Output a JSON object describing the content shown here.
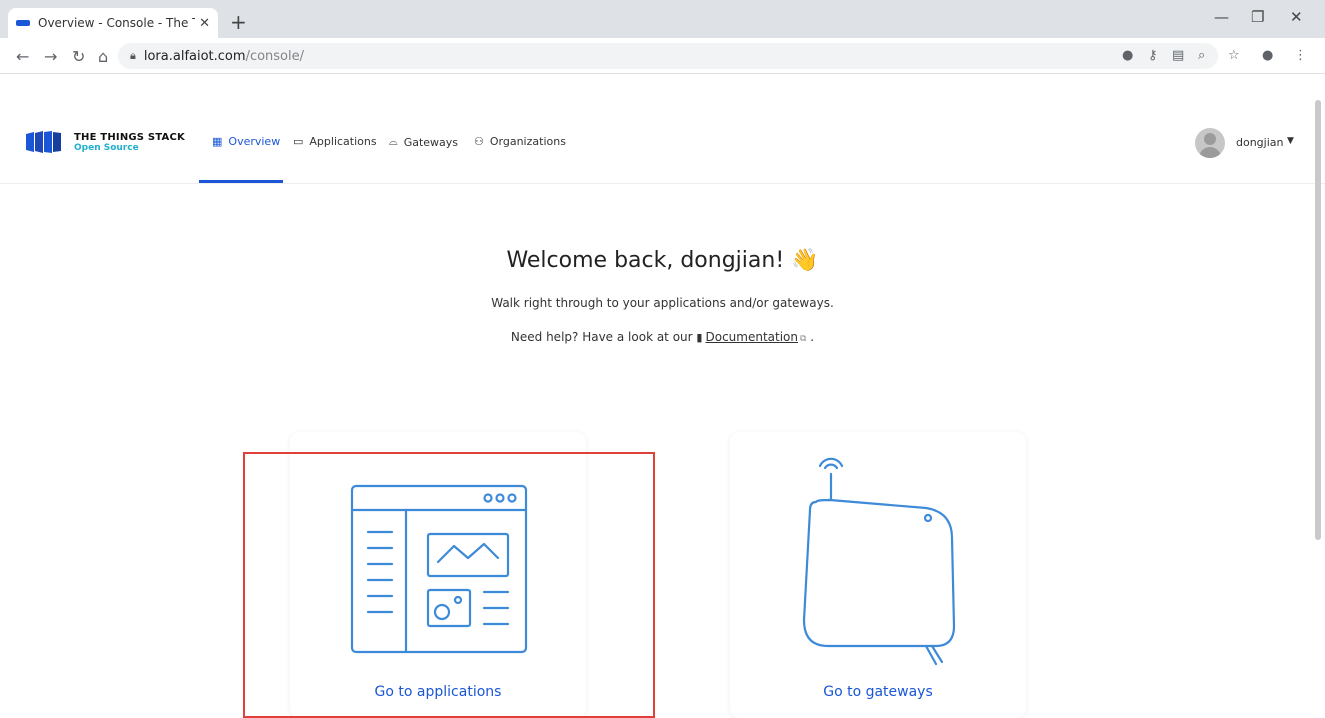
{
  "browser": {
    "tab_title": "Overview - Console - The Thin",
    "url_host": "lora.alfaiot.com",
    "url_path": "/console/"
  },
  "app": {
    "brand_line1": "THE THINGS STACK",
    "brand_line2": "Open Source",
    "nav": [
      {
        "label": "Overview",
        "icon": "grid-icon",
        "active": true
      },
      {
        "label": "Applications",
        "icon": "window-icon",
        "active": false
      },
      {
        "label": "Gateways",
        "icon": "gateway-icon",
        "active": false
      },
      {
        "label": "Organizations",
        "icon": "people-icon",
        "active": false
      }
    ],
    "username": "dongjian"
  },
  "main": {
    "welcome": "Welcome back, dongjian!",
    "subtitle": "Walk right through to your applications and/or gateways.",
    "help_prefix": "Need help? Have a look at our",
    "help_link": "Documentation",
    "help_suffix": ".",
    "cards": [
      {
        "label": "Go to applications",
        "icon": "application-illustration-icon"
      },
      {
        "label": "Go to gateways",
        "icon": "gateway-illustration-icon"
      }
    ]
  },
  "colors": {
    "accent": "#1a56d6",
    "brand_sub": "#22b0ce",
    "highlight": "#e0403a"
  }
}
